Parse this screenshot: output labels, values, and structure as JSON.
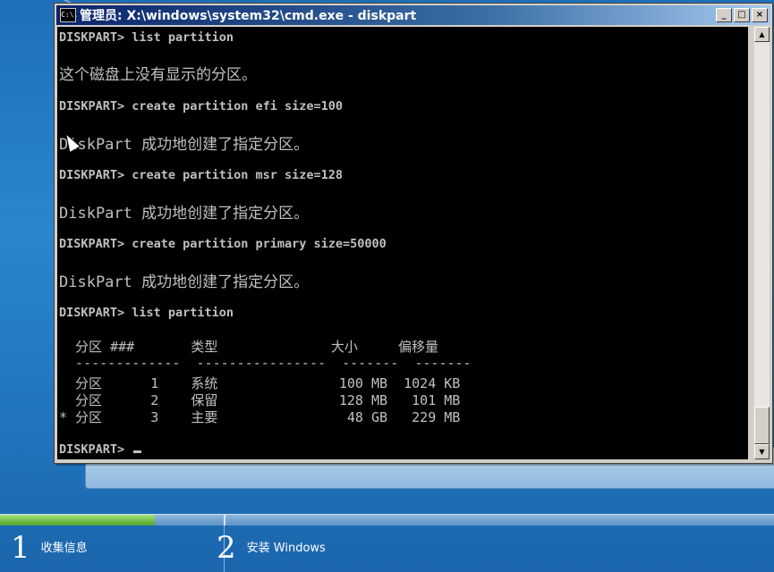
{
  "window": {
    "title": "管理员: X:\\windows\\system32\\cmd.exe - diskpart",
    "icon_label": "C:\\.",
    "buttons": {
      "minimize": "_",
      "maximize": "□",
      "close": "×"
    }
  },
  "console": {
    "lines": [
      "DISKPART> list partition",
      "这个磁盘上没有显示的分区。",
      "DISKPART> create partition efi size=100",
      "DiskPart 成功地创建了指定分区。",
      "DISKPART> create partition msr size=128",
      "DiskPart 成功地创建了指定分区。",
      "DISKPART> create partition primary size=50000",
      "DiskPart 成功地创建了指定分区。",
      "DISKPART> list partition"
    ],
    "table": {
      "header": "  分区 ###       类型              大小     偏移量",
      "divider": "  -------------  ----------------  -------  -------",
      "rows": [
        "  分区      1    系统               100 MB  1024 KB",
        "  分区      2    保留               128 MB   101 MB",
        "* 分区      3    主要                48 GB   229 MB"
      ]
    },
    "prompt": "DISKPART> "
  },
  "setup_progress": {
    "progress_percent": 20,
    "steps": [
      {
        "number": "1",
        "label": "收集信息"
      },
      {
        "number": "2",
        "label": "安装 Windows"
      }
    ]
  }
}
